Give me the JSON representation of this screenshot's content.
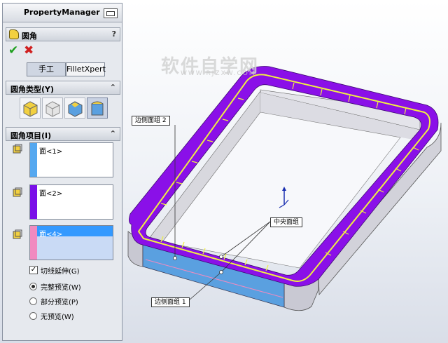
{
  "property_manager": {
    "title": "PropertyManager",
    "feature_name": "圆角",
    "help": "?",
    "ok_symbol": "✔",
    "cancel_symbol": "✖",
    "tabs": {
      "manual": "手工",
      "expert": "FilletXpert"
    },
    "fillet_type": {
      "label": "圆角类型(Y)",
      "selected_index": 3
    },
    "fillet_items": {
      "label": "圆角项目(I)",
      "lists": [
        {
          "text": "面<1>",
          "color": "#55a8f0",
          "selected": false
        },
        {
          "text": "面<2>",
          "color": "#7a0fe8",
          "selected": false
        },
        {
          "text": "面<4>",
          "color": "#f08ac0",
          "selected": true
        }
      ],
      "tangent_propagation": {
        "label": "切线延伸(G)",
        "checked": true
      },
      "preview_options": [
        {
          "label": "完整预览(W)",
          "checked": true
        },
        {
          "label": "部分预览(P)",
          "checked": false
        },
        {
          "label": "无预览(W)",
          "checked": false
        }
      ]
    },
    "collapse_symbol": "⌃"
  },
  "viewport": {
    "watermark_main": "软件自学网",
    "watermark_url": "WWW.RJZXW.COM",
    "callouts": {
      "side_face_2": "边侧面组 2",
      "center_face": "中央面组",
      "side_face_1": "边侧面组 1"
    },
    "colors": {
      "side_face_2": "#8a10e8",
      "center_face": "#f0f040",
      "side_face_1": "#5aa0e0",
      "body": "#d6d6dc"
    }
  }
}
